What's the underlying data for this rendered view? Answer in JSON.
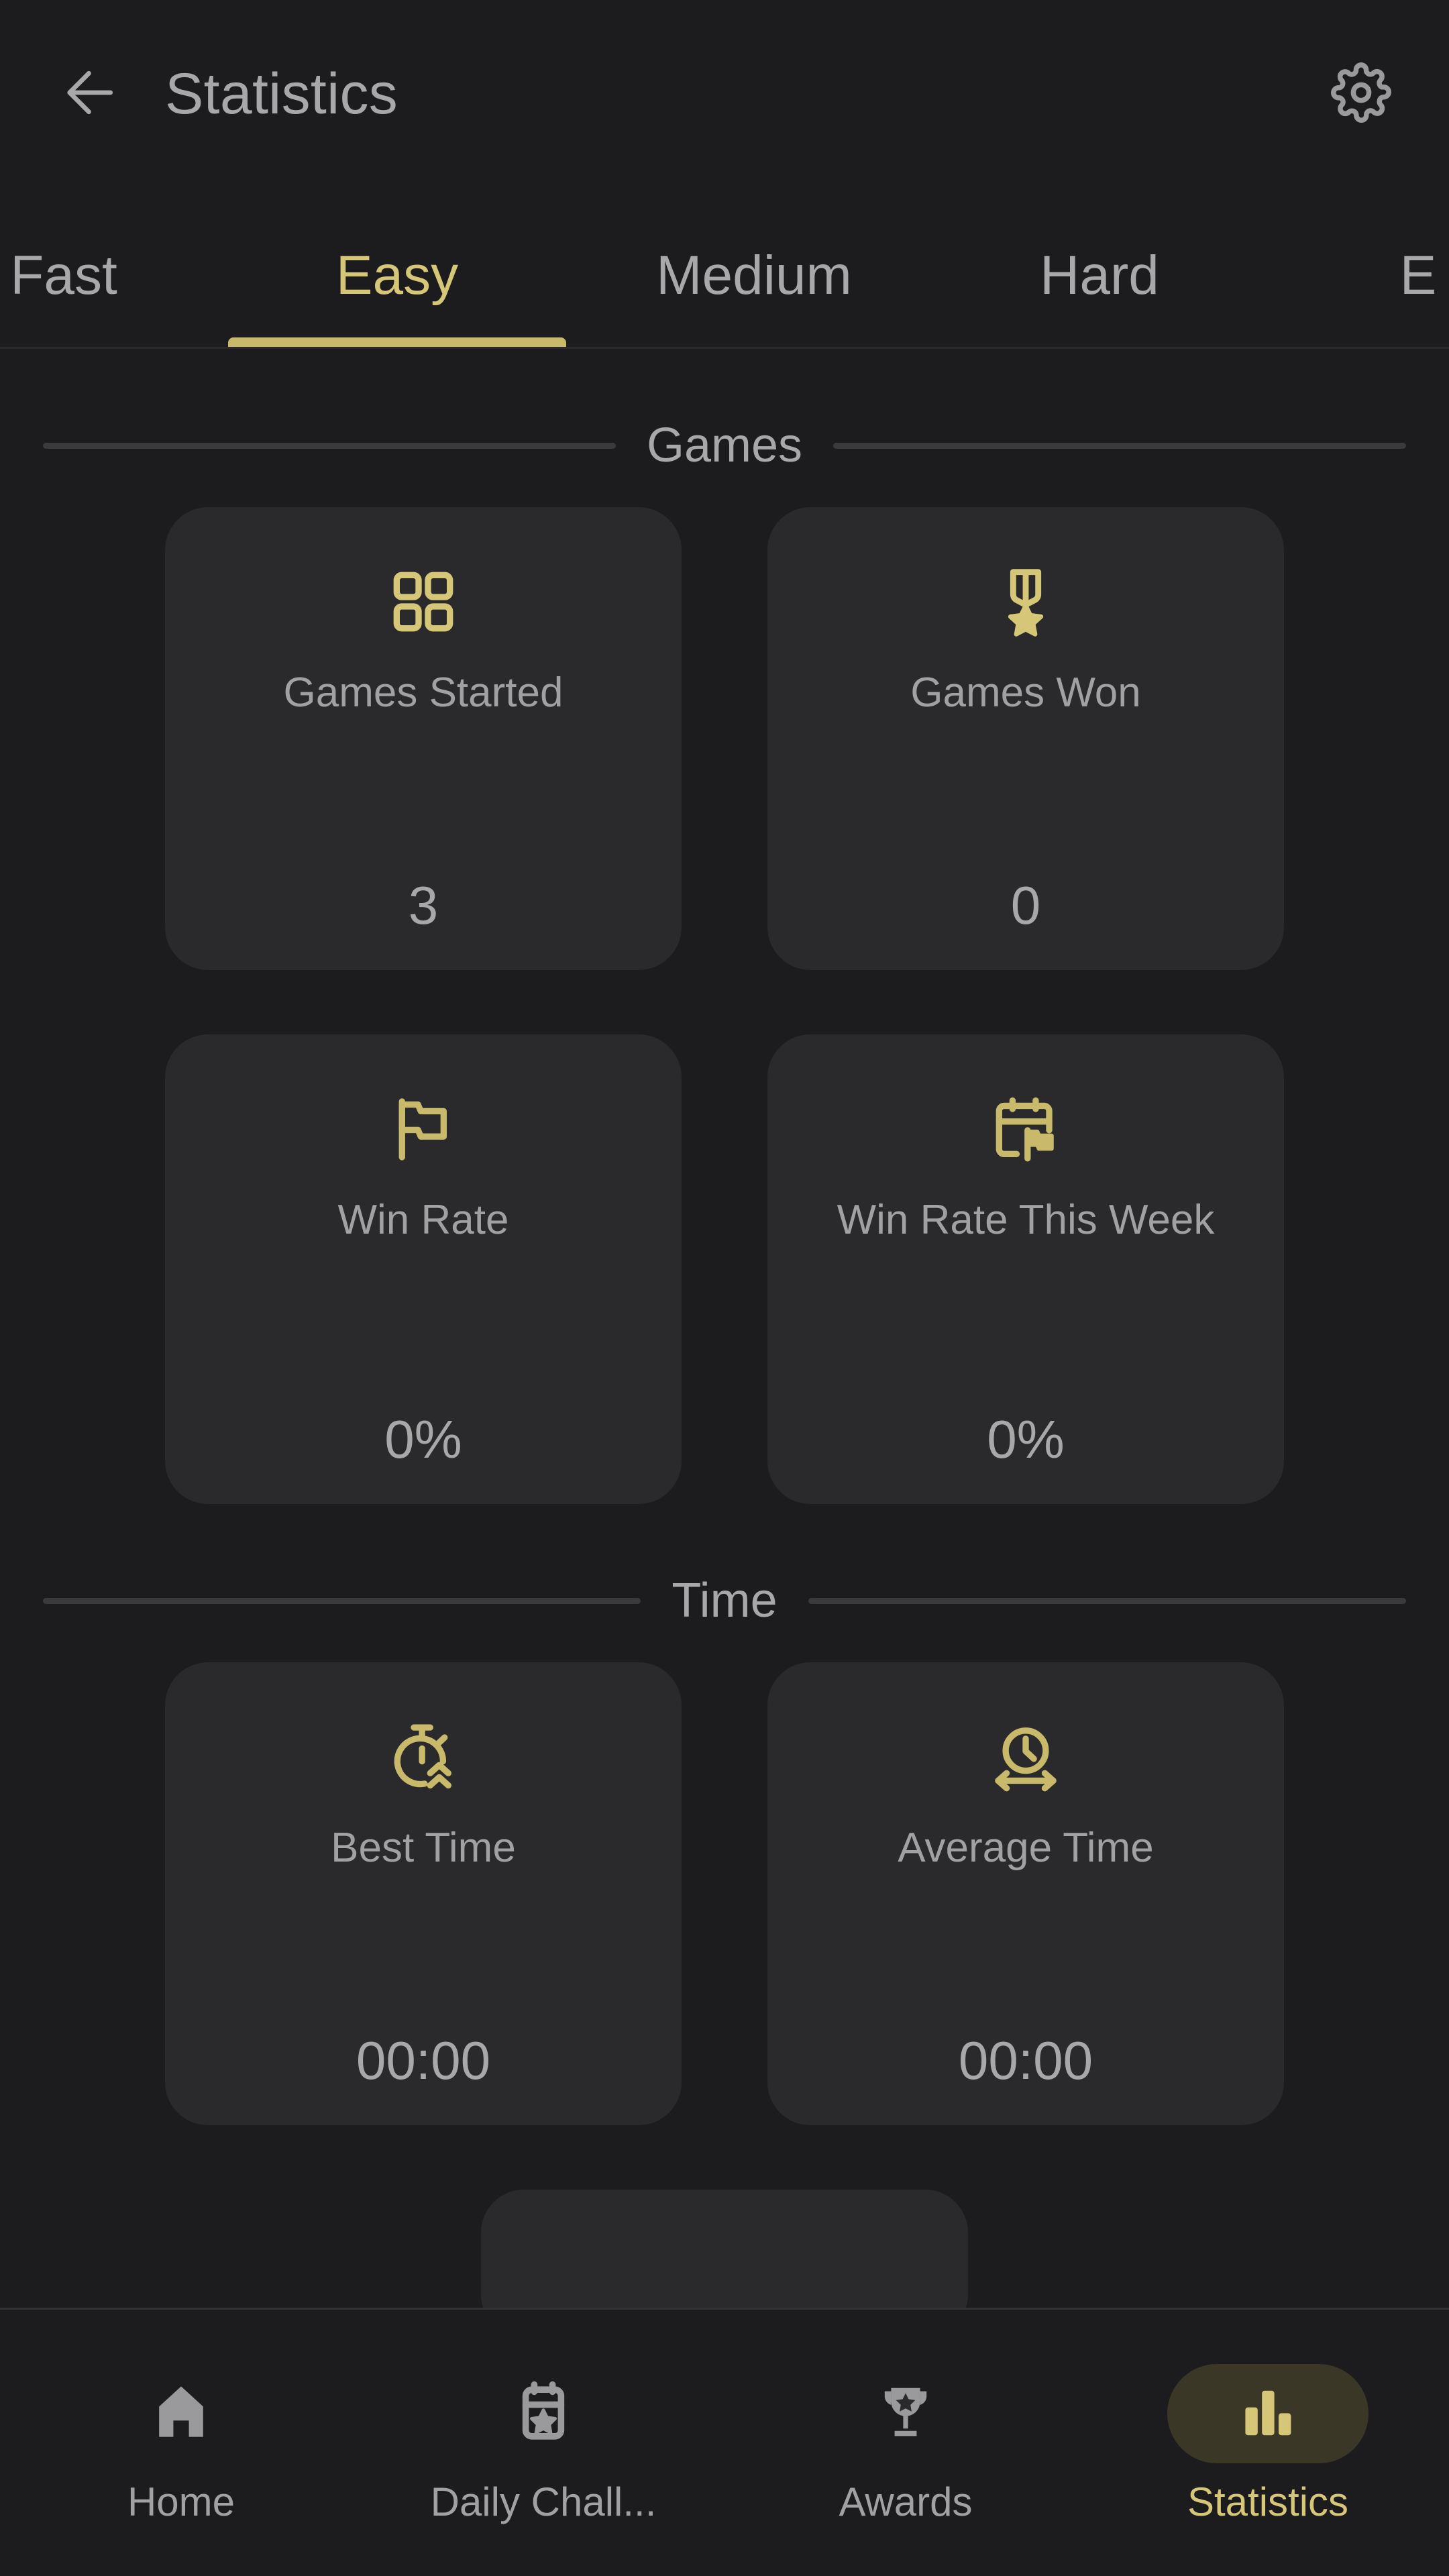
{
  "header": {
    "back_icon": "arrow-left-icon",
    "title": "Statistics",
    "settings_icon": "gear-icon"
  },
  "difficulty_tabs": {
    "active": "Easy",
    "items": [
      {
        "label": "Fast",
        "active": false,
        "partially_visible": true
      },
      {
        "label": "Easy",
        "active": true,
        "partially_visible": false
      },
      {
        "label": "Medium",
        "active": false,
        "partially_visible": false
      },
      {
        "label": "Hard",
        "active": false,
        "partially_visible": false
      },
      {
        "label": "E",
        "active": false,
        "partially_visible": true
      }
    ]
  },
  "sections": [
    {
      "title": "Games",
      "rows": [
        [
          {
            "icon": "grid-four-squares-icon",
            "label": "Games Started",
            "value": "3"
          },
          {
            "icon": "medal-icon",
            "label": "Games Won",
            "value": "0"
          }
        ],
        [
          {
            "icon": "flag-icon",
            "label": "Win Rate",
            "value": "0%"
          },
          {
            "icon": "calendar-flag-icon",
            "label": "Win Rate This Week",
            "value": "0%"
          }
        ]
      ]
    },
    {
      "title": "Time",
      "rows": [
        [
          {
            "icon": "stopwatch-fast-icon",
            "label": "Best Time",
            "value": "00:00"
          },
          {
            "icon": "clock-span-icon",
            "label": "Average Time",
            "value": "00:00"
          }
        ]
      ]
    }
  ],
  "peek_card": {
    "icon": "flag-clock-icon"
  },
  "bottom_nav": {
    "active": "Statistics",
    "items": [
      {
        "label": "Home",
        "icon": "home-icon",
        "active": false
      },
      {
        "label": "Daily Chall...",
        "icon": "calendar-star-icon",
        "active": false
      },
      {
        "label": "Awards",
        "icon": "trophy-icon",
        "active": false
      },
      {
        "label": "Statistics",
        "icon": "bar-chart-icon",
        "active": true
      }
    ]
  },
  "colors": {
    "background": "#1c1c1e",
    "card": "#2a2a2c",
    "accent_gold": "#d6c678",
    "accent_gold_dim": "#c9b96b",
    "text_primary": "#a8a8ab",
    "text_secondary": "#a1a1a4",
    "nav_active_pill": "#3a3726",
    "divider": "#3a3a3d"
  }
}
